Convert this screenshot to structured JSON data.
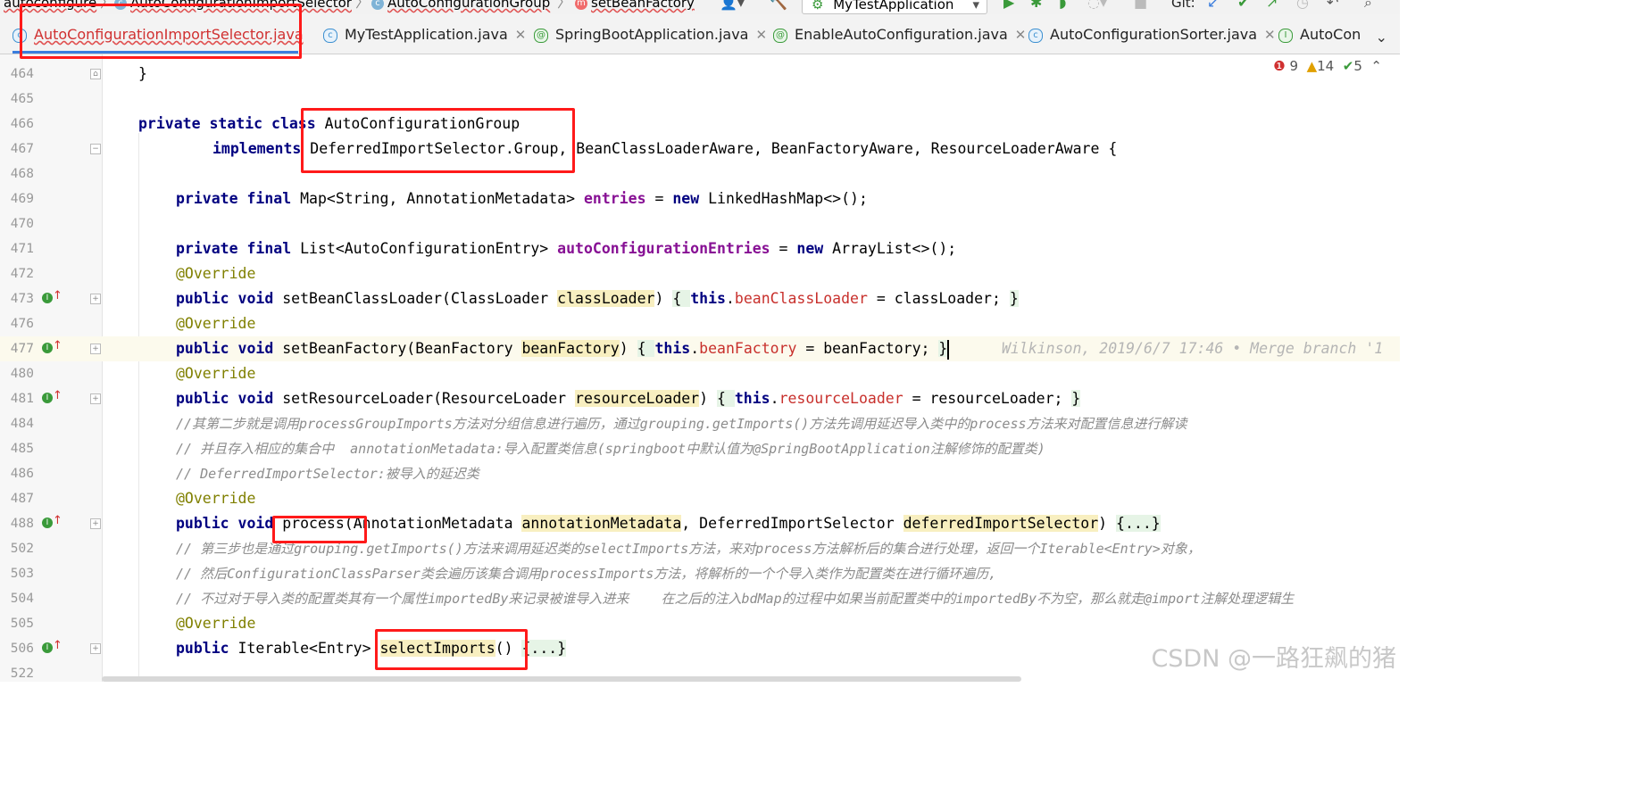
{
  "breadcrumb": {
    "items": [
      {
        "label": "autoconfigure",
        "icon": "none"
      },
      {
        "label": "AutoConfigurationImportSelector",
        "icon": "class-icon"
      },
      {
        "label": "AutoConfigurationGroup",
        "icon": "class-icon"
      },
      {
        "label": "setBeanFactory",
        "icon": "method-icon"
      }
    ]
  },
  "toolbar": {
    "run_config": "MyTestApplication",
    "git_label": "Git:"
  },
  "tabs": [
    {
      "label": "AutoConfigurationImportSelector.java",
      "active": true,
      "icon": "class-icon"
    },
    {
      "label": "MyTestApplication.java",
      "active": false,
      "icon": "class-icon"
    },
    {
      "label": "SpringBootApplication.java",
      "active": false,
      "icon": "annotation-icon"
    },
    {
      "label": "EnableAutoConfiguration.java",
      "active": false,
      "icon": "annotation-icon"
    },
    {
      "label": "AutoConfigurationSorter.java",
      "active": false,
      "icon": "class-icon"
    },
    {
      "label": "AutoCon",
      "active": false,
      "icon": "interface-icon"
    }
  ],
  "inspections": {
    "errors": "9",
    "warnings": "14",
    "ok": "5"
  },
  "lines": {
    "l464": "464",
    "l465": "465",
    "l466": "466",
    "l467": "467",
    "l468": "468",
    "l469": "469",
    "l470": "470",
    "l471": "471",
    "l472": "472",
    "l473": "473",
    "l476": "476",
    "l477": "477",
    "l480": "480",
    "l481": "481",
    "l484": "484",
    "l485": "485",
    "l486": "486",
    "l487": "487",
    "l488": "488",
    "l502": "502",
    "l503": "503",
    "l504": "504",
    "l505": "505",
    "l506": "506",
    "l522": "522"
  },
  "code": {
    "c464": "}",
    "c466_kw": "private static class ",
    "c466_name": "AutoConfigurationGroup",
    "c467_kw": "implements ",
    "c467_rest": "DeferredImportSelector.Group, BeanClassLoaderAware, BeanFactoryAware, ResourceLoaderAware {",
    "c469_kw": "private final ",
    "c469_type": "Map<String, AnnotationMetadata> ",
    "c469_field": "entries",
    "c469_eq": " = ",
    "c469_new": "new ",
    "c469_end": "LinkedHashMap<>();",
    "c471_kw": "private final ",
    "c471_type": "List<AutoConfigurationEntry> ",
    "c471_field": "autoConfigurationEntries",
    "c471_eq": " = ",
    "c471_new": "new ",
    "c471_end": "ArrayList<>();",
    "override": "@Override",
    "c473_kw": "public void ",
    "c473_sig": "setBeanClassLoader(ClassLoader ",
    "c473_param": "classLoader",
    "c473_mid": ") ",
    "c473_open": "{ ",
    "c473_this": "this",
    "c473_dot": ".",
    "c473_field": "beanClassLoader",
    "c473_rest": " = classLoader; ",
    "c473_close": "}",
    "c477_kw": "public void ",
    "c477_sig": "setBeanFactory(BeanFactory ",
    "c477_param": "beanFactory",
    "c477_mid": ") ",
    "c477_open": "{ ",
    "c477_this": "this",
    "c477_dot": ".",
    "c477_field": "beanFactory",
    "c477_rest": " = beanFactory; ",
    "c477_close": "}",
    "c477_blame": "Wilkinson, 2019/6/7 17:46 • Merge branch '1",
    "c481_kw": "public void ",
    "c481_sig": "setResourceLoader(ResourceLoader ",
    "c481_param": "resourceLoader",
    "c481_mid": ") ",
    "c481_open": "{ ",
    "c481_this": "this",
    "c481_dot": ".",
    "c481_field": "resourceLoader",
    "c481_rest": " = resourceLoader; ",
    "c481_close": "}",
    "c484": "//其第二步就是调用processGroupImports方法对分组信息进行遍历，通过grouping.getImports()方法先调用延迟导入类中的process方法来对配置信息进行解读",
    "c485": "// 并且存入相应的集合中  annotationMetadata:导入配置类信息(springboot中默认值为@SpringBootApplication注解修饰的配置类)",
    "c486": "// DeferredImportSelector:被导入的延迟类",
    "c488_kw": "public void ",
    "c488_name": "process",
    "c488_sig": "(AnnotationMetadata ",
    "c488_p1": "annotationMetadata",
    "c488_mid": ", DeferredImportSelector ",
    "c488_p2": "deferredImportSelector",
    "c488_close": ") ",
    "c488_fold": "{...}",
    "c502": "// 第三步也是通过grouping.getImports()方法来调用延迟类的selectImports方法，来对process方法解析后的集合进行处理，返回一个Iterable<Entry>对象，",
    "c503": "// 然后ConfigurationClassParser类会遍历该集合调用processImports方法，将解析的一个个导入类作为配置类在进行循环遍历,",
    "c504": "// 不过对于导入类的配置类其有一个属性importedBy来记录被谁导入进来    在之后的注入bdMap的过程中如果当前配置类中的importedBy不为空，那么就走@import注解处理逻辑生",
    "c506_kw": "public ",
    "c506_type": "Iterable<Entry> ",
    "c506_name": "selectImports",
    "c506_paren": "()",
    "c506_fold": "{...}"
  },
  "watermark": "CSDN @一路狂飙的猪"
}
